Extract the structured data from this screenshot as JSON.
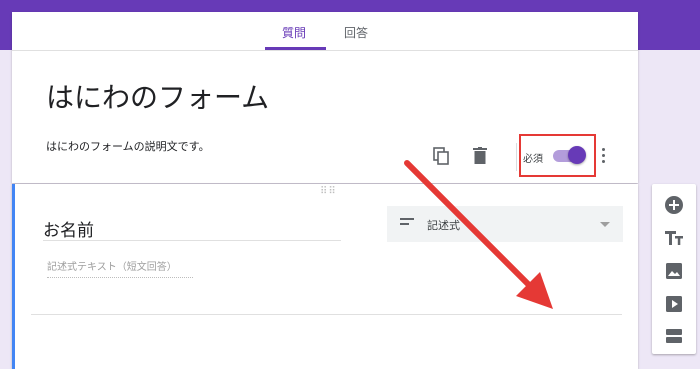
{
  "tabs": [
    {
      "label": "質問",
      "active": true
    },
    {
      "label": "回答",
      "active": false
    }
  ],
  "form": {
    "title": "はにわのフォーム",
    "description": "はにわのフォームの説明文です。"
  },
  "question": {
    "title": "お名前",
    "type_label": "記述式",
    "answer_hint": "記述式テキスト（短文回答）",
    "required_label": "必須",
    "required": true
  },
  "toolbar_icons": [
    "add-question-icon",
    "add-title-icon",
    "add-image-icon",
    "add-video-icon",
    "add-section-icon"
  ],
  "colors": {
    "theme": "#673ab7",
    "background": "#ede7f6",
    "accent_border": "#4285f4",
    "annotation": "#e53935"
  }
}
